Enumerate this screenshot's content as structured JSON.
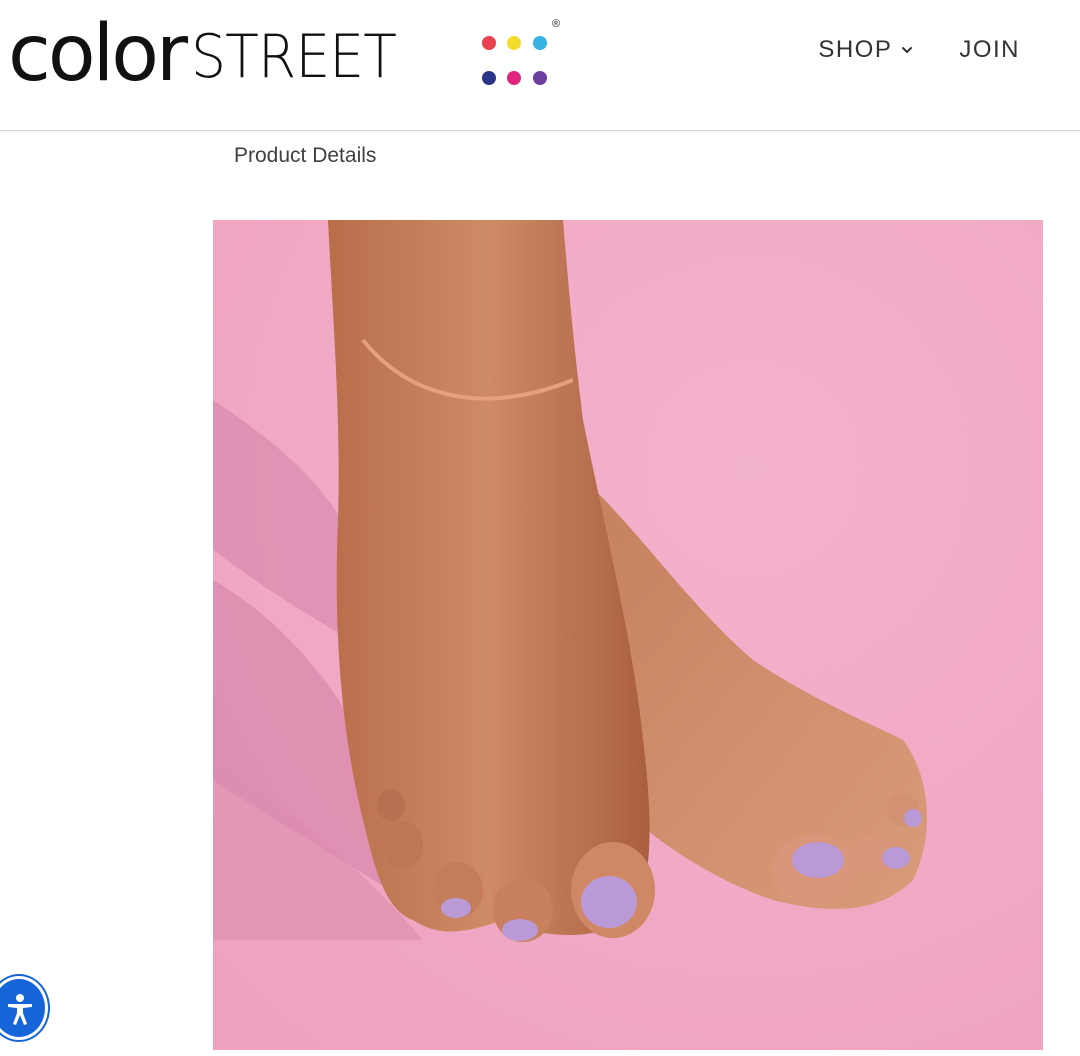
{
  "brand": {
    "logo_part1": "color",
    "logo_part2": "STREET",
    "registered_mark": "®",
    "dot_colors": [
      "#e8424e",
      "#f4dd2a",
      "#37b2e3",
      "#2b3585",
      "#e0257f",
      "#6a3fa0"
    ]
  },
  "nav": {
    "shop_label": "SHOP",
    "join_label": "JOIN"
  },
  "page": {
    "section_title": "Product Details"
  },
  "colors": {
    "image_background": "#f2a9c6",
    "polish": "#b99ad6",
    "accessibility_button": "#1565d8"
  },
  "icons": {
    "shop_dropdown": "chevron-down-icon",
    "accessibility": "accessibility-icon"
  }
}
